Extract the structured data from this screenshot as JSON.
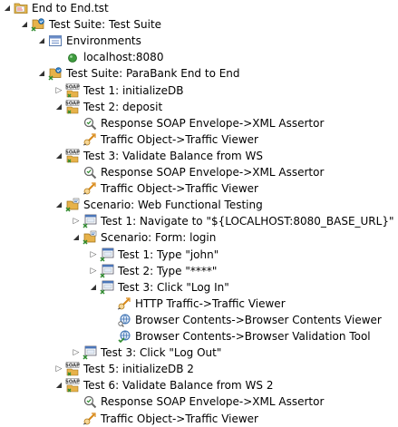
{
  "tree": {
    "rows": [
      {
        "label": "End to End.tst",
        "icon": "folder-icon",
        "twisty": "expanded",
        "depth": 0
      },
      {
        "label": "Test Suite: Test Suite",
        "icon": "test-suite-icon",
        "twisty": "expanded",
        "depth": 1
      },
      {
        "label": "Environments",
        "icon": "environments-icon",
        "twisty": "expanded",
        "depth": 2
      },
      {
        "label": "localhost:8080",
        "icon": "environment-active-icon",
        "twisty": "none",
        "depth": 3
      },
      {
        "label": "Test Suite: ParaBank End to End",
        "icon": "test-suite-icon",
        "twisty": "expanded",
        "depth": 2
      },
      {
        "label": "Test 1: initializeDB",
        "icon": "soap-client-icon",
        "twisty": "collapsed",
        "depth": 3
      },
      {
        "label": "Test 2: deposit",
        "icon": "soap-client-icon",
        "twisty": "expanded",
        "depth": 3
      },
      {
        "label": "Response SOAP Envelope->XML Assertor",
        "icon": "xml-assertor-icon",
        "twisty": "none",
        "depth": 4
      },
      {
        "label": "Traffic Object->Traffic Viewer",
        "icon": "traffic-viewer-icon",
        "twisty": "none",
        "depth": 4
      },
      {
        "label": "Test 3: Validate Balance from WS",
        "icon": "soap-client-icon",
        "twisty": "expanded",
        "depth": 3
      },
      {
        "label": "Response SOAP Envelope->XML Assertor",
        "icon": "xml-assertor-icon",
        "twisty": "none",
        "depth": 4
      },
      {
        "label": "Traffic Object->Traffic Viewer",
        "icon": "traffic-viewer-icon",
        "twisty": "none",
        "depth": 4
      },
      {
        "label": "Scenario: Web Functional Testing",
        "icon": "scenario-icon",
        "twisty": "expanded",
        "depth": 3
      },
      {
        "label": "Test 1: Navigate to \"${LOCALHOST:8080_BASE_URL}\"",
        "icon": "browser-test-icon",
        "twisty": "collapsed",
        "depth": 4
      },
      {
        "label": "Scenario: Form: login",
        "icon": "scenario-icon",
        "twisty": "expanded",
        "depth": 4
      },
      {
        "label": "Test 1: Type \"john\"",
        "icon": "browser-test-icon",
        "twisty": "collapsed",
        "depth": 5
      },
      {
        "label": "Test 2: Type \"****\"",
        "icon": "browser-test-icon",
        "twisty": "collapsed",
        "depth": 5
      },
      {
        "label": "Test 3: Click \"Log In\"",
        "icon": "browser-test-icon",
        "twisty": "expanded",
        "depth": 5
      },
      {
        "label": "HTTP Traffic->Traffic Viewer",
        "icon": "traffic-viewer-icon",
        "twisty": "none",
        "depth": 6
      },
      {
        "label": "Browser Contents->Browser Contents Viewer",
        "icon": "browser-contents-viewer-icon",
        "twisty": "none",
        "depth": 6
      },
      {
        "label": "Browser Contents->Browser Validation Tool",
        "icon": "browser-validation-icon",
        "twisty": "none",
        "depth": 6
      },
      {
        "label": "Test 3: Click \"Log Out\"",
        "icon": "browser-test-icon",
        "twisty": "collapsed",
        "depth": 4
      },
      {
        "label": "Test 5: initializeDB 2",
        "icon": "soap-client-icon",
        "twisty": "collapsed",
        "depth": 3
      },
      {
        "label": "Test 6: Validate Balance from WS 2",
        "icon": "soap-client-icon",
        "twisty": "expanded",
        "depth": 3
      },
      {
        "label": "Response SOAP Envelope->XML Assertor",
        "icon": "xml-assertor-icon",
        "twisty": "none",
        "depth": 4
      },
      {
        "label": "Traffic Object->Traffic Viewer",
        "icon": "traffic-viewer-icon",
        "twisty": "none",
        "depth": 4
      }
    ]
  }
}
